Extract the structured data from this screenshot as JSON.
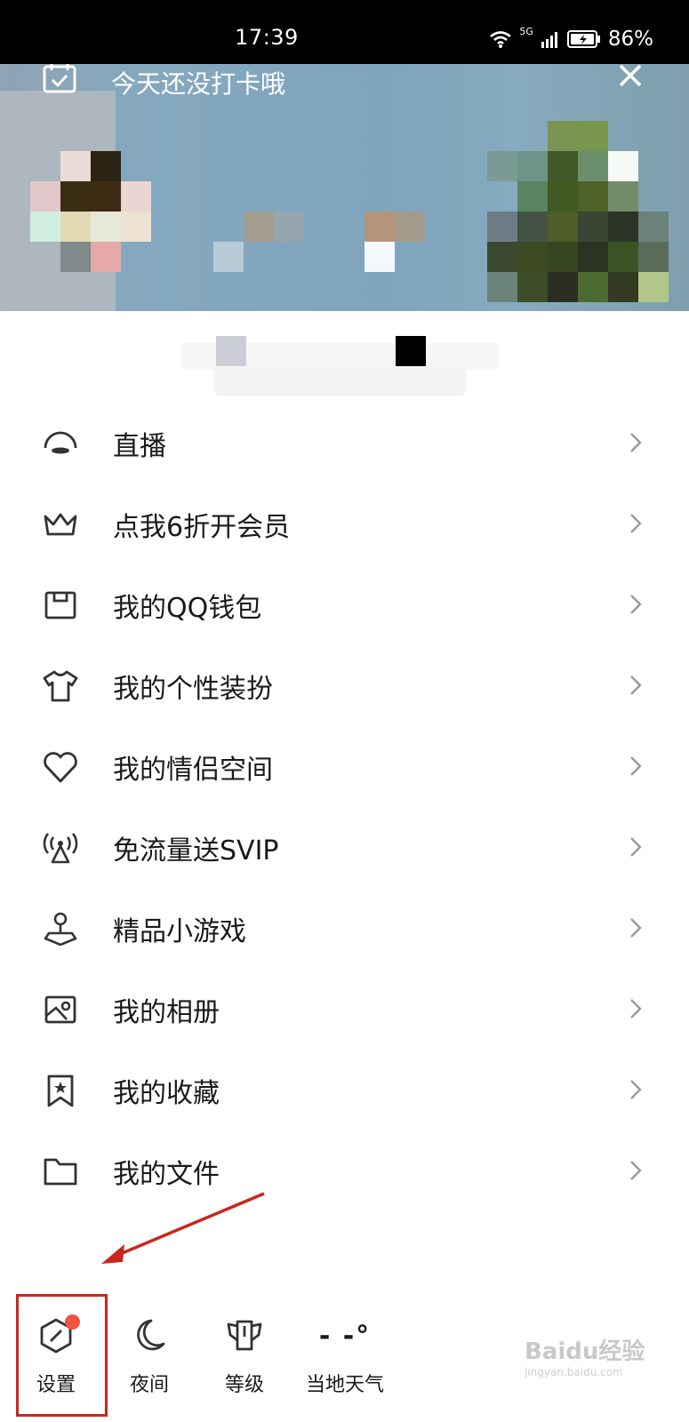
{
  "status_bar": {
    "time": "17:39",
    "network": "5G",
    "battery": "86%"
  },
  "banner": {
    "checkin_text": "今天还没打卡哦",
    "checkin_icon": "calendar-check-icon",
    "close_icon": "close-icon"
  },
  "menu": {
    "items": [
      {
        "label": "直播",
        "icon": "live-icon"
      },
      {
        "label": "点我6折开会员",
        "icon": "crown-icon"
      },
      {
        "label": "我的QQ钱包",
        "icon": "wallet-icon"
      },
      {
        "label": "我的个性装扮",
        "icon": "tshirt-icon"
      },
      {
        "label": "我的情侣空间",
        "icon": "heart-icon"
      },
      {
        "label": "免流量送SVIP",
        "icon": "signal-tower-icon"
      },
      {
        "label": "精品小游戏",
        "icon": "joystick-icon"
      },
      {
        "label": "我的相册",
        "icon": "photo-album-icon"
      },
      {
        "label": "我的收藏",
        "icon": "bookmark-star-icon"
      },
      {
        "label": "我的文件",
        "icon": "folder-icon"
      }
    ]
  },
  "bottom_bar": {
    "settings_label": "设置",
    "night_label": "夜间",
    "level_label": "等级",
    "weather_label": "当地天气",
    "weather_value": "- -°"
  },
  "watermark": {
    "text": "Baidu经验",
    "url": "jingyan.baidu.com"
  },
  "colors": {
    "highlight": "#c8271f",
    "badge": "#f4533e"
  }
}
